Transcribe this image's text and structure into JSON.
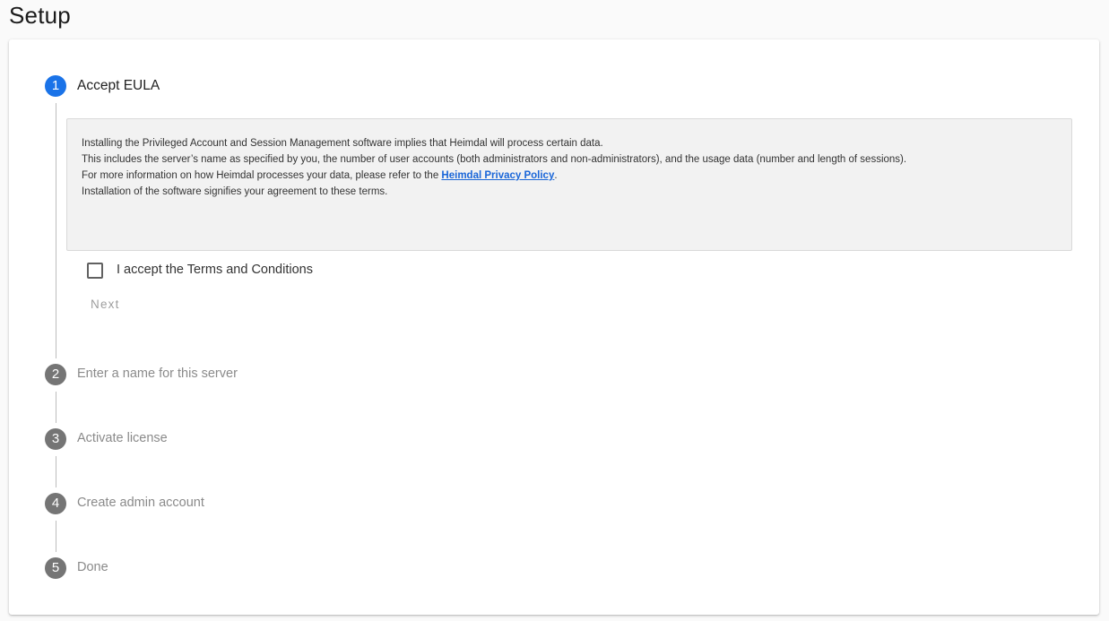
{
  "page": {
    "title": "Setup"
  },
  "colors": {
    "active_step": "#1a73e8",
    "inactive_step": "#757575",
    "link": "#1a66d8"
  },
  "stepper": {
    "steps": [
      {
        "number": "1",
        "label": "Accept EULA",
        "state": "active"
      },
      {
        "number": "2",
        "label": "Enter a name for this server",
        "state": "inactive"
      },
      {
        "number": "3",
        "label": "Activate license",
        "state": "inactive"
      },
      {
        "number": "4",
        "label": "Create admin account",
        "state": "inactive"
      },
      {
        "number": "5",
        "label": "Done",
        "state": "inactive"
      }
    ]
  },
  "eula": {
    "line1": "Installing the Privileged Account and Session Management software implies that Heimdal will process certain data.",
    "line2": "This includes the server’s name as specified by you, the number of user accounts (both administrators and non-administrators), and the usage data (number and length of sessions).",
    "line3_prefix": "For more information on how Heimdal processes your data, please refer to the ",
    "line3_link": "Heimdal Privacy Policy",
    "line3_suffix": ".",
    "line4": "Installation of the software signifies your agreement to these terms."
  },
  "terms": {
    "checkbox_label": "I accept the Terms and Conditions",
    "checked": false
  },
  "actions": {
    "next_label": "Next",
    "next_enabled": false
  }
}
